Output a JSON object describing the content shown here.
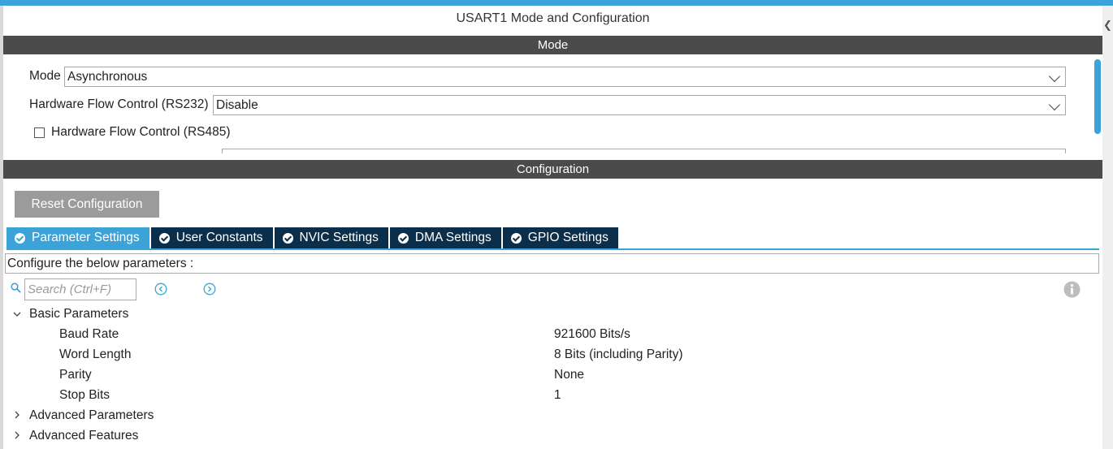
{
  "panel": {
    "title": "USART1 Mode and Configuration"
  },
  "mode_section": {
    "header": "Mode",
    "mode_label": "Mode",
    "mode_value": "Asynchronous",
    "flow_rs232_label": "Hardware Flow Control (RS232)",
    "flow_rs232_value": "Disable",
    "flow_rs485_label": "Hardware Flow Control (RS485)",
    "flow_rs485_checked": false
  },
  "config_section": {
    "header": "Configuration",
    "reset_button": "Reset Configuration",
    "tabs": [
      {
        "label": "Parameter Settings",
        "active": true
      },
      {
        "label": "User Constants",
        "active": false
      },
      {
        "label": "NVIC Settings",
        "active": false
      },
      {
        "label": "DMA Settings",
        "active": false
      },
      {
        "label": "GPIO Settings",
        "active": false
      }
    ],
    "description": "Configure the below parameters :",
    "search": {
      "placeholder": "Search (Ctrl+F)",
      "value": ""
    },
    "groups": [
      {
        "label": "Basic Parameters",
        "expanded": true,
        "params": [
          {
            "name": "Baud Rate",
            "value": "921600 Bits/s"
          },
          {
            "name": "Word Length",
            "value": "8 Bits (including Parity)"
          },
          {
            "name": "Parity",
            "value": "None"
          },
          {
            "name": "Stop Bits",
            "value": "1"
          }
        ]
      },
      {
        "label": "Advanced Parameters",
        "expanded": false
      },
      {
        "label": "Advanced Features",
        "expanded": false
      }
    ]
  },
  "colors": {
    "accent": "#3ba3d8",
    "section_bar": "#4b4b4b",
    "tab_inactive": "#0b2f4a",
    "button": "#9b9b9b"
  }
}
